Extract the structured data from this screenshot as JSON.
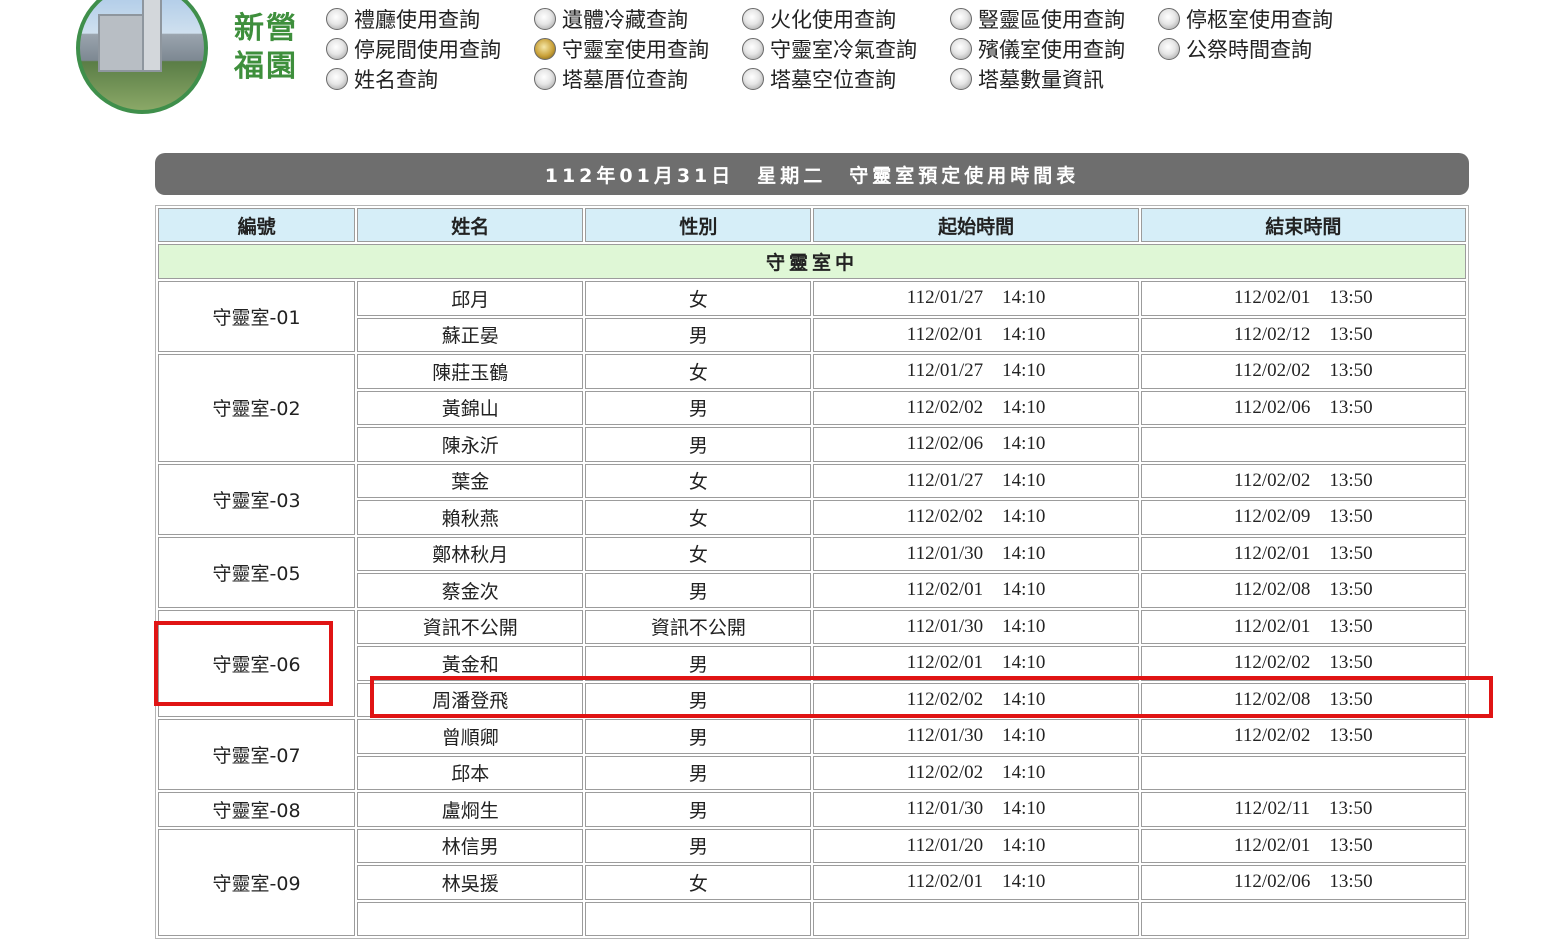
{
  "brand": {
    "line1": "新營",
    "line2": "福園"
  },
  "nav": [
    {
      "label": "禮廳使用查詢",
      "active": false
    },
    {
      "label": "遺體冷藏查詢",
      "active": false
    },
    {
      "label": "火化使用查詢",
      "active": false
    },
    {
      "label": "豎靈區使用查詢",
      "active": false
    },
    {
      "label": "停柩室使用查詢",
      "active": false
    },
    {
      "label": "停屍間使用查詢",
      "active": false
    },
    {
      "label": "守靈室使用查詢",
      "active": true
    },
    {
      "label": "守靈室冷氣查詢",
      "active": false
    },
    {
      "label": "殯儀室使用查詢",
      "active": false
    },
    {
      "label": "公祭時間查詢",
      "active": false
    },
    {
      "label": "姓名查詢",
      "active": false
    },
    {
      "label": "塔墓厝位查詢",
      "active": false
    },
    {
      "label": "塔墓空位查詢",
      "active": false
    },
    {
      "label": "塔墓數量資訊",
      "active": false
    }
  ],
  "title": "112年01月31日　星期二　守靈室預定使用時間表",
  "table": {
    "headers": [
      "編號",
      "姓名",
      "性別",
      "起始時間",
      "結束時間"
    ],
    "section": "守靈室中",
    "groups": [
      {
        "room": "守靈室-01",
        "rows": [
          {
            "name": "邱月",
            "gender": "女",
            "start": "112/01/27    14:10",
            "end": "112/02/01    13:50"
          },
          {
            "name": "蘇正晏",
            "gender": "男",
            "start": "112/02/01    14:10",
            "end": "112/02/12    13:50"
          }
        ]
      },
      {
        "room": "守靈室-02",
        "rows": [
          {
            "name": "陳莊玉鶴",
            "gender": "女",
            "start": "112/01/27    14:10",
            "end": "112/02/02    13:50"
          },
          {
            "name": "黃錦山",
            "gender": "男",
            "start": "112/02/02    14:10",
            "end": "112/02/06    13:50"
          },
          {
            "name": "陳永沂",
            "gender": "男",
            "start": "112/02/06    14:10",
            "end": ""
          }
        ]
      },
      {
        "room": "守靈室-03",
        "rows": [
          {
            "name": "葉金",
            "gender": "女",
            "start": "112/01/27    14:10",
            "end": "112/02/02    13:50"
          },
          {
            "name": "賴秋燕",
            "gender": "女",
            "start": "112/02/02    14:10",
            "end": "112/02/09    13:50"
          }
        ]
      },
      {
        "room": "守靈室-05",
        "rows": [
          {
            "name": "鄭林秋月",
            "gender": "女",
            "start": "112/01/30    14:10",
            "end": "112/02/01    13:50"
          },
          {
            "name": "蔡金次",
            "gender": "男",
            "start": "112/02/01    14:10",
            "end": "112/02/08    13:50"
          }
        ]
      },
      {
        "room": "守靈室-06",
        "rows": [
          {
            "name": "資訊不公開",
            "gender": "資訊不公開",
            "start": "112/01/30    14:10",
            "end": "112/02/01    13:50"
          },
          {
            "name": "黃金和",
            "gender": "男",
            "start": "112/02/01    14:10",
            "end": "112/02/02    13:50"
          },
          {
            "name": "周潘登飛",
            "gender": "男",
            "start": "112/02/02    14:10",
            "end": "112/02/08    13:50"
          }
        ]
      },
      {
        "room": "守靈室-07",
        "rows": [
          {
            "name": "曾順卿",
            "gender": "男",
            "start": "112/01/30    14:10",
            "end": "112/02/02    13:50"
          },
          {
            "name": "邱本",
            "gender": "男",
            "start": "112/02/02    14:10",
            "end": ""
          }
        ]
      },
      {
        "room": "守靈室-08",
        "rows": [
          {
            "name": "盧烱生",
            "gender": "男",
            "start": "112/01/30    14:10",
            "end": "112/02/11    13:50"
          }
        ]
      },
      {
        "room": "守靈室-09",
        "rows": [
          {
            "name": "林信男",
            "gender": "男",
            "start": "112/01/20    14:10",
            "end": "112/02/01    13:50"
          },
          {
            "name": "林吳援",
            "gender": "女",
            "start": "112/02/01    14:10",
            "end": "112/02/06    13:50"
          },
          {
            "name": "",
            "gender": "",
            "start": "",
            "end": ""
          }
        ]
      }
    ]
  },
  "colors": {
    "accent_green": "#3e8f3c",
    "highlight_red": "#e01414",
    "header_blue": "#d6eef8",
    "section_green": "#dff7d6",
    "title_gray": "#6e6e6e"
  },
  "highlight": {
    "room": "守靈室-06",
    "row_name": "周潘登飛"
  }
}
